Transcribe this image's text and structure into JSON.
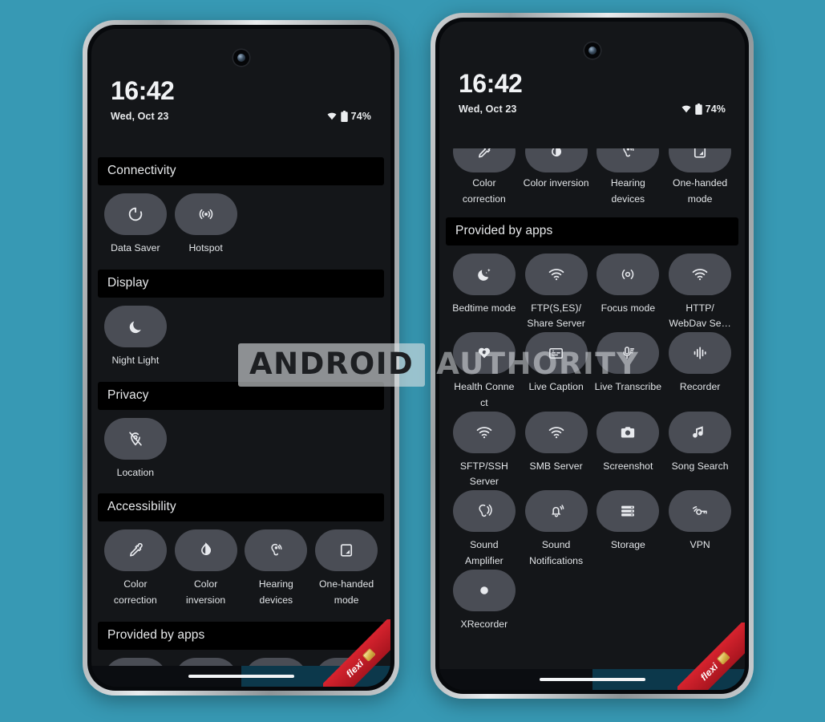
{
  "background_color": "#3799b4",
  "watermark": {
    "part1": "ANDROID",
    "part2": "AUTHORITY"
  },
  "ribbon": {
    "label": "flexi"
  },
  "phones": {
    "left": {
      "status": {
        "time": "16:42",
        "date": "Wed, Oct 23",
        "battery_percent": "74%",
        "wifi_icon": "wifi-icon",
        "battery_icon": "battery-icon"
      },
      "sections": [
        {
          "header": "Connectivity",
          "tiles": [
            {
              "label": "Data Saver",
              "icon": "data-saver-icon"
            },
            {
              "label": "Hotspot",
              "icon": "hotspot-icon"
            }
          ]
        },
        {
          "header": "Display",
          "tiles": [
            {
              "label": "Night Light",
              "icon": "night-light-icon"
            }
          ]
        },
        {
          "header": "Privacy",
          "tiles": [
            {
              "label": "Location",
              "icon": "location-off-icon"
            }
          ]
        },
        {
          "header": "Accessibility",
          "tiles": [
            {
              "label": "Color correction",
              "icon": "eyedropper-icon"
            },
            {
              "label": "Color inversion",
              "icon": "contrast-icon"
            },
            {
              "label": "Hearing devices",
              "icon": "hearing-icon"
            },
            {
              "label": "One-handed mode",
              "icon": "one-handed-icon"
            }
          ]
        },
        {
          "header": "Provided by apps",
          "tiles": [
            {
              "label": "",
              "icon": "bedtime-icon"
            },
            {
              "label": "",
              "icon": "wifi-icon"
            },
            {
              "label": "",
              "icon": "focus-mode-icon"
            },
            {
              "label": "",
              "icon": "wifi-icon"
            }
          ]
        }
      ]
    },
    "right": {
      "status": {
        "time": "16:42",
        "date": "Wed, Oct 23",
        "battery_percent": "74%",
        "wifi_icon": "wifi-icon",
        "battery_icon": "battery-icon"
      },
      "clipped_top_row": {
        "tiles": [
          {
            "label": "Color correction",
            "icon": "eyedropper-icon"
          },
          {
            "label": "Color inversion",
            "icon": "contrast-icon"
          },
          {
            "label": "Hearing devices",
            "icon": "hearing-icon"
          },
          {
            "label": "One-handed mode",
            "icon": "one-handed-icon"
          }
        ]
      },
      "sections": [
        {
          "header": "Provided by apps",
          "tiles": [
            {
              "label": "Bedtime mode",
              "icon": "bedtime-icon"
            },
            {
              "label": "FTP(S,ES)/ Share Server",
              "icon": "wifi-icon"
            },
            {
              "label": "Focus mode",
              "icon": "focus-mode-icon"
            },
            {
              "label": "HTTP/ WebDav Se…",
              "icon": "wifi-icon"
            },
            {
              "label": "Health Conne ct",
              "icon": "health-connect-icon"
            },
            {
              "label": "Live Caption",
              "icon": "live-caption-icon"
            },
            {
              "label": "Live Transcribe",
              "icon": "live-transcribe-icon"
            },
            {
              "label": "Recorder",
              "icon": "recorder-icon"
            },
            {
              "label": "SFTP/SSH Server",
              "icon": "wifi-icon"
            },
            {
              "label": "SMB Server",
              "icon": "wifi-icon"
            },
            {
              "label": "Screenshot",
              "icon": "camera-icon"
            },
            {
              "label": "Song Search",
              "icon": "music-note-icon"
            },
            {
              "label": "Sound Amplifier",
              "icon": "sound-amplifier-icon"
            },
            {
              "label": "Sound Notifications",
              "icon": "bell-ring-icon"
            },
            {
              "label": "Storage",
              "icon": "storage-icon"
            },
            {
              "label": "VPN",
              "icon": "vpn-key-icon"
            },
            {
              "label": "XRecorder",
              "icon": "record-dot-icon"
            }
          ]
        }
      ]
    }
  }
}
